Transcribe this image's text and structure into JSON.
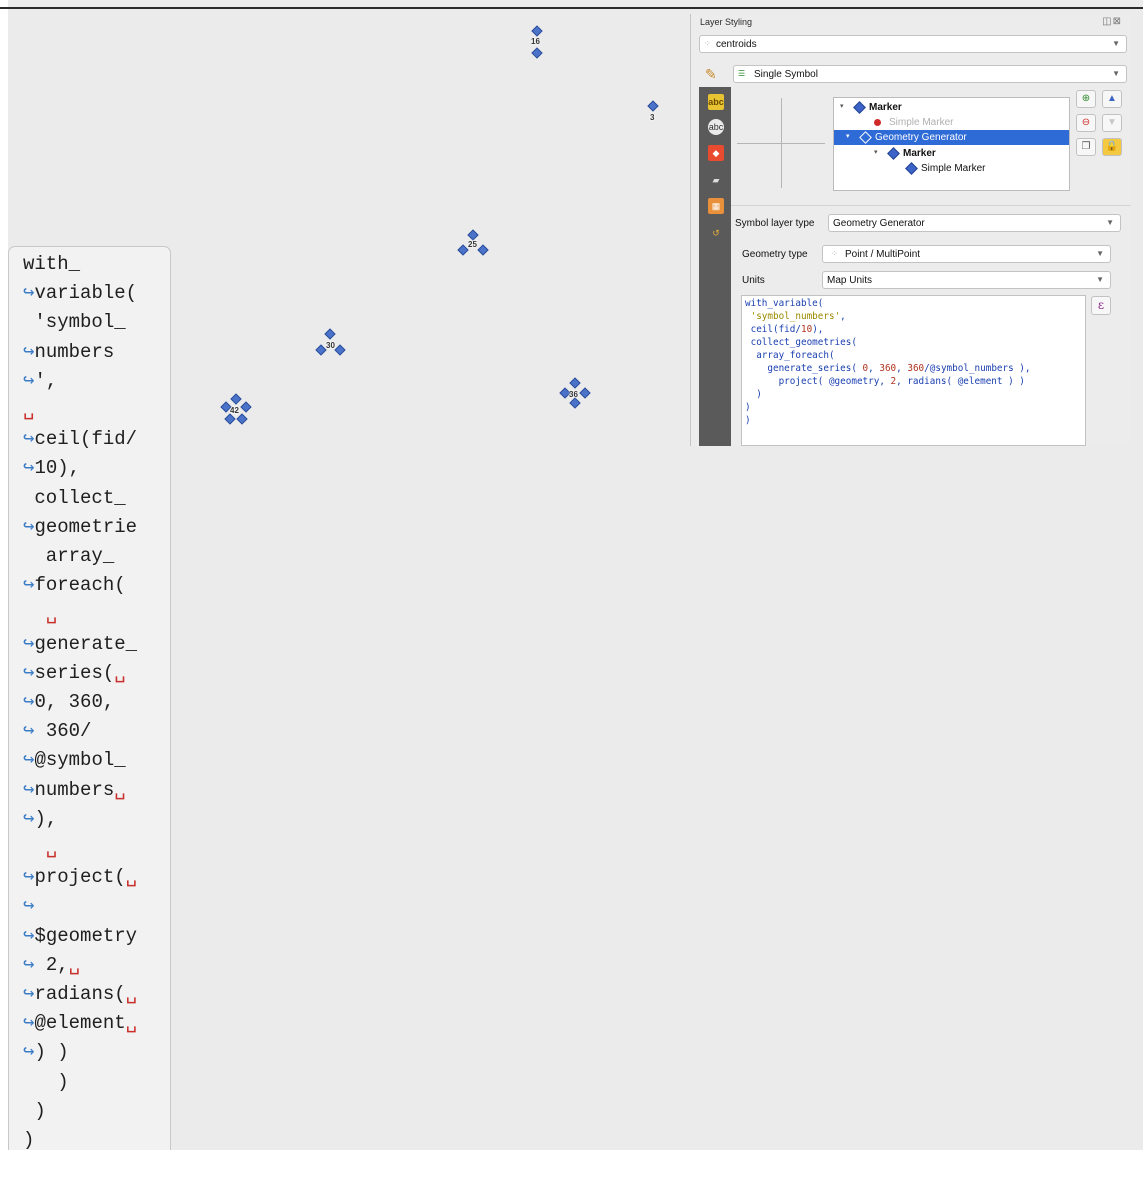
{
  "map": {
    "clusters": [
      {
        "label": "16"
      },
      {
        "label": "3"
      },
      {
        "label": "25"
      },
      {
        "label": "30"
      },
      {
        "label": "42"
      },
      {
        "label": "36"
      }
    ]
  },
  "code_block": {
    "lines": [
      {
        "t": "with_"
      },
      {
        "c": "↪",
        "t": "variable("
      },
      {
        "t": " 'symbol_"
      },
      {
        "c": "↪",
        "t": "numbers"
      },
      {
        "c": "↪",
        "t": "',"
      },
      {
        "s": "␣"
      },
      {
        "c": "↪",
        "t": "ceil(fid/"
      },
      {
        "c": "↪",
        "t": "10),"
      },
      {
        "t": " collect_"
      },
      {
        "c": "↪",
        "t": "geometrie"
      },
      {
        "t": "  array_"
      },
      {
        "c": "↪",
        "t": "foreach("
      },
      {
        "s": "  ␣"
      },
      {
        "c": "↪",
        "t": "generate_"
      },
      {
        "c": "↪",
        "t": "series(",
        "s": "␣"
      },
      {
        "c": "↪",
        "t": "0, 360,"
      },
      {
        "c": "↪",
        "t": " 360/"
      },
      {
        "c": "↪",
        "t": "@symbol_"
      },
      {
        "c": "↪",
        "t": "numbers",
        "s": "␣"
      },
      {
        "c": "↪",
        "t": "),"
      },
      {
        "s": "  ␣"
      },
      {
        "c": "↪",
        "t": "project(",
        "s": "␣"
      },
      {
        "c": "↪"
      },
      {
        "c": "↪",
        "t": "$geometry"
      },
      {
        "c": "↪",
        "t": " 2,",
        "s": "␣"
      },
      {
        "c": "↪",
        "t": "radians(",
        "s": "␣"
      },
      {
        "c": "↪",
        "t": "@element",
        "s": "␣"
      },
      {
        "c": "↪",
        "t": ") )"
      },
      {
        "t": "   )"
      },
      {
        "t": " )"
      },
      {
        "t": ")"
      }
    ]
  },
  "panel": {
    "title": "Layer Styling",
    "layer_select": "centroids",
    "renderer_select": "Single Symbol",
    "symbol_tree": [
      {
        "label": "Marker",
        "icon": "diamond-icon",
        "bold": true,
        "level": 0,
        "twisty": "▾"
      },
      {
        "label": "Simple Marker",
        "icon": "dot-icon",
        "faded": true,
        "level": 1
      },
      {
        "label": "Geometry Generator",
        "icon": "diamond-outline-icon",
        "selected": true,
        "level": 1,
        "twisty": "▾"
      },
      {
        "label": "Marker",
        "icon": "diamond-icon",
        "bold": true,
        "level": 2,
        "twisty": "▾"
      },
      {
        "label": "Simple Marker",
        "icon": "diamond-icon",
        "level": 3
      }
    ],
    "symbol_layer_type_label": "Symbol layer type",
    "symbol_layer_type_value": "Geometry Generator",
    "geometry_type_label": "Geometry type",
    "geometry_type_value": "Point / MultiPoint",
    "units_label": "Units",
    "units_value": "Map Units",
    "expression_button": "ε",
    "expression_lines": [
      [
        {
          "t": "with_variable("
        }
      ],
      [
        {
          "t": " "
        },
        {
          "s": "'symbol_numbers'"
        },
        {
          "t": ","
        }
      ],
      [
        {
          "t": " ceil(fid/"
        },
        {
          "n": "10"
        },
        {
          "t": "),"
        }
      ],
      [
        {
          "t": " collect_geometries("
        }
      ],
      [
        {
          "t": "  array_foreach("
        }
      ],
      [
        {
          "t": "    generate_series( "
        },
        {
          "n": "0"
        },
        {
          "t": ", "
        },
        {
          "n": "360"
        },
        {
          "t": ", "
        },
        {
          "n": "360"
        },
        {
          "t": "/@symbol_numbers ),"
        }
      ],
      [
        {
          "t": "      project( @geometry, "
        },
        {
          "n": "2"
        },
        {
          "t": ", radians( @element ) )"
        }
      ],
      [
        {
          "t": "  )"
        }
      ],
      [
        {
          "t": ")"
        }
      ],
      [
        {
          "t": ")"
        }
      ]
    ]
  }
}
